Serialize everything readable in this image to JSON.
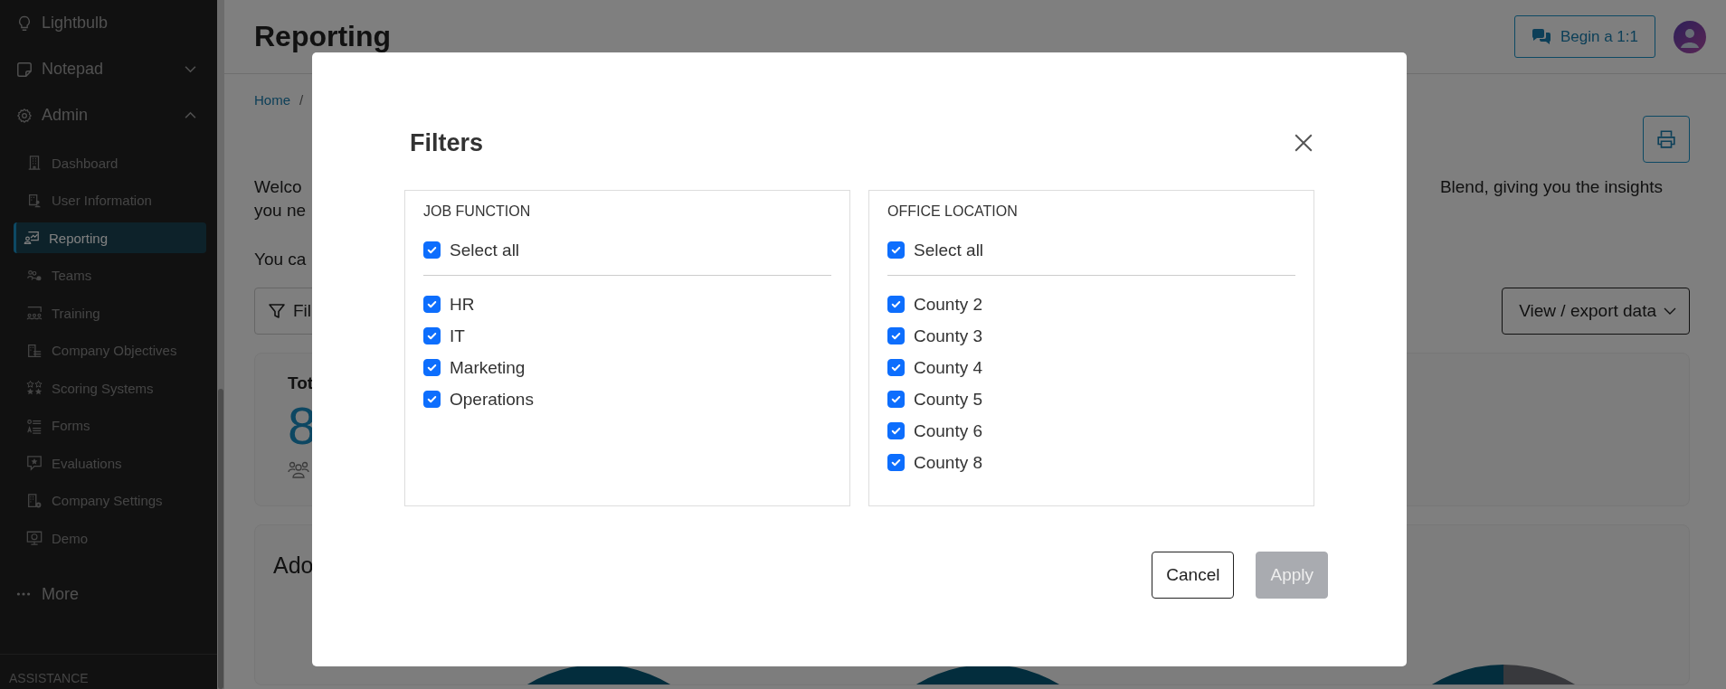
{
  "sidebar": {
    "items": [
      {
        "label": "Lightbulb",
        "kind": "link"
      },
      {
        "label": "Notepad",
        "kind": "group",
        "expanded": false
      },
      {
        "label": "Admin",
        "kind": "group",
        "expanded": true,
        "children": [
          {
            "label": "Dashboard",
            "selected": false
          },
          {
            "label": "User Information",
            "selected": false
          },
          {
            "label": "Reporting",
            "selected": true
          },
          {
            "label": "Teams",
            "selected": false
          },
          {
            "label": "Training",
            "selected": false
          },
          {
            "label": "Company Objectives",
            "selected": false
          },
          {
            "label": "Scoring Systems",
            "selected": false
          },
          {
            "label": "Forms",
            "selected": false
          },
          {
            "label": "Evaluations",
            "selected": false
          },
          {
            "label": "Company Settings",
            "selected": false
          },
          {
            "label": "Demo",
            "selected": false
          }
        ]
      },
      {
        "label": "More",
        "kind": "more"
      }
    ],
    "section_heading": "ASSISTANCE"
  },
  "header": {
    "title": "Reporting",
    "button": "Begin a 1:1"
  },
  "breadcrumb": {
    "items": [
      "Home"
    ],
    "separator": "/"
  },
  "intro": {
    "line_1": "Welco",
    "line_1_end": "Blend, giving you the insights",
    "line_2": "you ne",
    "line_3": "You ca"
  },
  "toolbar": {
    "filter_button": "Fil",
    "export_button": "View / export data"
  },
  "summary_card": {
    "title": "Tot",
    "value": "8"
  },
  "adoption_card": {
    "title": "Ado"
  },
  "modal": {
    "title": "Filters",
    "groups": [
      {
        "heading": "JOB FUNCTION",
        "select_all": {
          "label": "Select all",
          "checked": true
        },
        "options": [
          {
            "label": "HR",
            "checked": true
          },
          {
            "label": "IT",
            "checked": true
          },
          {
            "label": "Marketing",
            "checked": true
          },
          {
            "label": "Operations",
            "checked": true
          }
        ]
      },
      {
        "heading": "OFFICE LOCATION",
        "select_all": {
          "label": "Select all",
          "checked": true
        },
        "options": [
          {
            "label": "County 2",
            "checked": true
          },
          {
            "label": "County 3",
            "checked": true
          },
          {
            "label": "County 4",
            "checked": true
          },
          {
            "label": "County 5",
            "checked": true
          },
          {
            "label": "County 6",
            "checked": true
          },
          {
            "label": "County 8",
            "checked": true
          }
        ]
      }
    ],
    "buttons": [
      {
        "label": "Cancel",
        "kind": "secondary",
        "disabled": false
      },
      {
        "label": "Apply",
        "kind": "primary",
        "disabled": true
      }
    ]
  }
}
